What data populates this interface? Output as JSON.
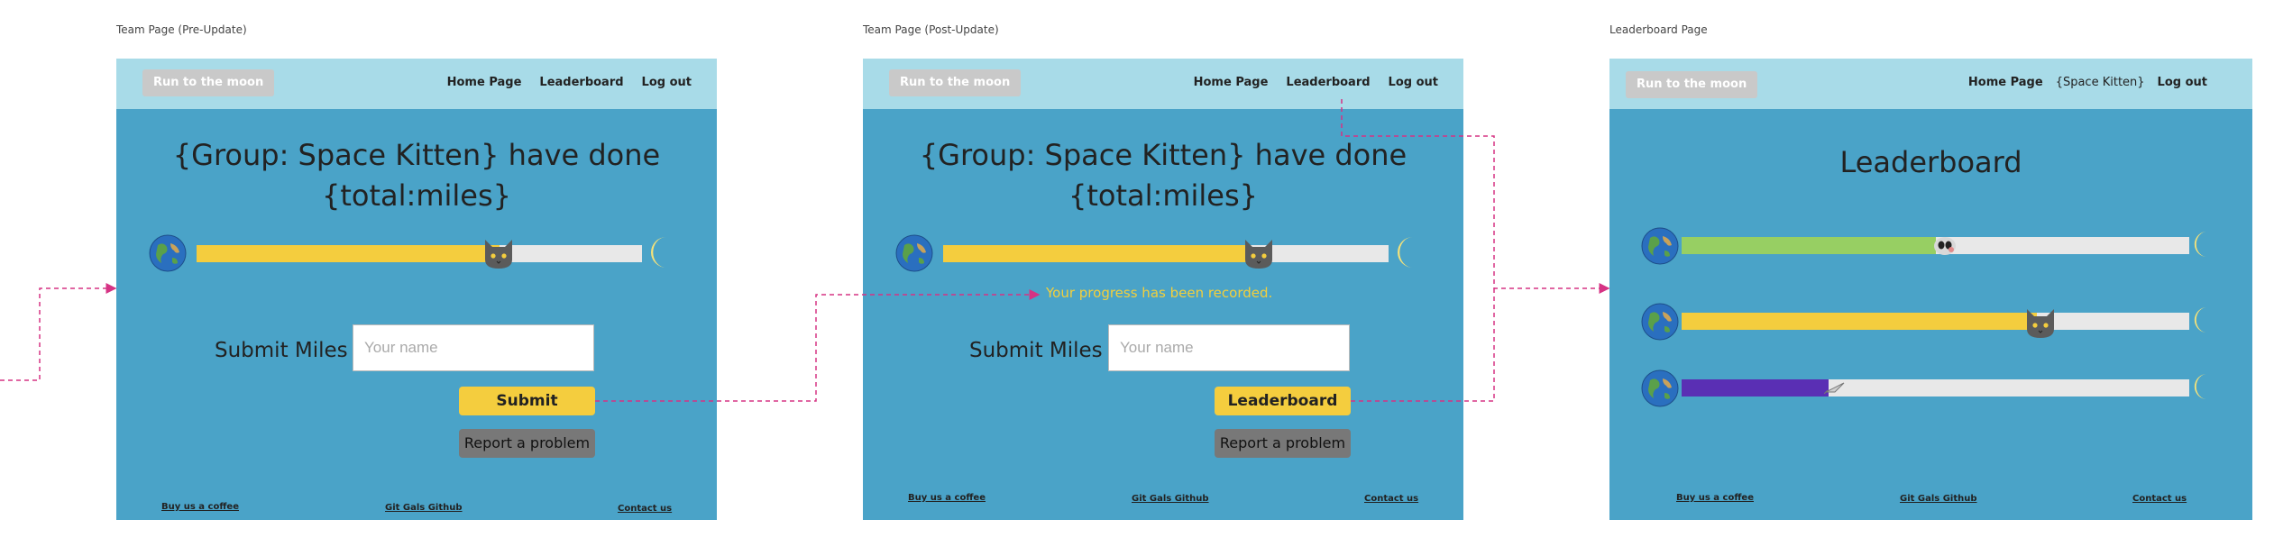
{
  "frames": {
    "pre": {
      "label": "Team Page (Pre-Update)",
      "brand": "Run to the moon",
      "nav": [
        "Home Page",
        "Leaderboard",
        "Log out"
      ],
      "headline_line1": "{Group: Space Kitten} have done",
      "headline_line2": "{total:miles}",
      "progress": 0.68,
      "submit_label": "Submit Miles",
      "name_placeholder": "Your name",
      "primary_button": "Submit",
      "report_button": "Report a problem",
      "footer": [
        "Buy us a coffee",
        "Git Gals Github",
        "Contact us"
      ]
    },
    "post": {
      "label": "Team Page (Post-Update)",
      "brand": "Run to the moon",
      "nav": [
        "Home Page",
        "Leaderboard",
        "Log out"
      ],
      "headline_line1": "{Group: Space Kitten} have done",
      "headline_line2": "{total:miles}",
      "progress": 0.68,
      "recorded_message": "Your progress has been recorded.",
      "submit_label": "Submit Miles",
      "name_placeholder": "Your name",
      "primary_button": "Leaderboard",
      "report_button": "Report a problem",
      "footer": [
        "Buy us a coffee",
        "Git Gals Github",
        "Contact us"
      ]
    },
    "leaderboard": {
      "label": "Leaderboard Page",
      "brand": "Run to the moon",
      "nav": [
        "Home Page",
        "{Space Kitten}",
        "Log out"
      ],
      "title": "Leaderboard",
      "teams": [
        {
          "color": "#97cf63",
          "progress": 0.5,
          "marker": "alien-icon"
        },
        {
          "color": "#f4cd3e",
          "progress": 0.7,
          "marker": "cat-icon"
        },
        {
          "color": "#5a2fb4",
          "progress": 0.29,
          "marker": "rocket-icon"
        }
      ],
      "footer": [
        "Buy us a coffee",
        "Git Gals Github",
        "Contact us"
      ]
    }
  },
  "colors": {
    "page_bg": "#4aa3c8",
    "navbar_bg": "#a8dbe8",
    "accent_yellow": "#f4cd3e",
    "connector": "#d63384"
  }
}
